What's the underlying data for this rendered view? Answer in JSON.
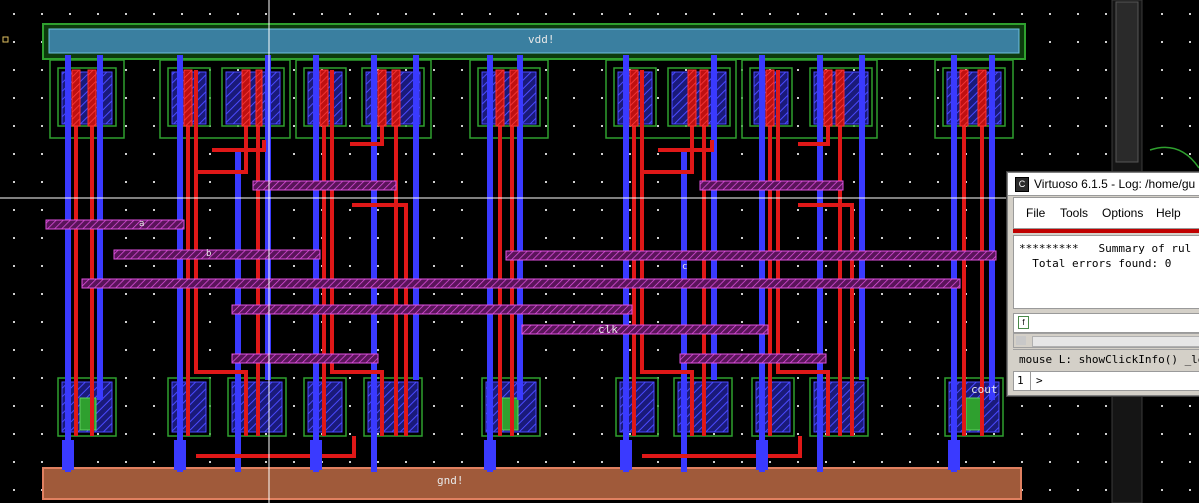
{
  "layout": {
    "net_labels": {
      "vdd": "vdd!",
      "gnd": "gnd!",
      "clk": "clk",
      "cout": "cout",
      "pin_a": "a",
      "pin_b": "b",
      "pin_c": "c"
    },
    "colors": {
      "background": "#000000",
      "metal1": "#3a3aff",
      "poly": "#e01818",
      "metal2": "#c030c0",
      "nwell": "#2fa02f",
      "vdd_rail": "#3a7fa0",
      "gnd_rail": "#a05a3a",
      "crosshair": "#ffffff"
    }
  },
  "log_window": {
    "title": "Virtuoso 6.1.5 - Log: /home/gu",
    "title_icon": "cadence-icon",
    "menu": [
      "File",
      "Tools",
      "Options",
      "Help"
    ],
    "output_lines": [
      "*********   Summary of rul",
      "  Total errors found: 0"
    ],
    "input_icon": "f",
    "status": "mouse L: showClickInfo() _leiL",
    "prompt_number": "1",
    "prompt_text": ">"
  }
}
